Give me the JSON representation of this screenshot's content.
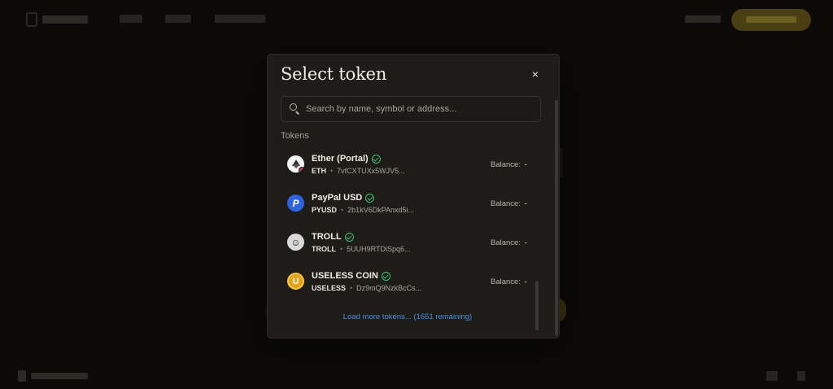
{
  "modal": {
    "title": "Select token",
    "close_glyph": "×",
    "search_placeholder": "Search by name, symbol or address...",
    "section_label": "Tokens",
    "load_more_label": "Load more tokens... (1651 remaining)",
    "tokens": [
      {
        "name": "Ether (Portal)",
        "symbol": "ETH",
        "address": "7vfCXTUXx5WJV5...",
        "balance_label": "Balance:",
        "balance_value": "-",
        "verified": true,
        "icon": "ether-logo-icon"
      },
      {
        "name": "PayPal USD",
        "symbol": "PYUSD",
        "address": "2b1kV6DkPAnxd5i...",
        "balance_label": "Balance:",
        "balance_value": "-",
        "verified": true,
        "icon": "paypal-logo-icon"
      },
      {
        "name": "TROLL",
        "symbol": "TROLL",
        "address": "5UUH9RTDiSpq6...",
        "balance_label": "Balance:",
        "balance_value": "-",
        "verified": true,
        "icon": "troll-face-icon"
      },
      {
        "name": "USELESS COIN",
        "symbol": "USELESS",
        "address": "Dz9mQ9NzkBcCs...",
        "balance_label": "Balance:",
        "balance_value": "-",
        "verified": true,
        "icon": "useless-coin-icon"
      }
    ],
    "token_separator": "•"
  },
  "colors": {
    "overlay_bg": "#0b0a08",
    "modal_bg": "#1d1c19",
    "verified": "#3fbf6d",
    "link": "#4a8fe2",
    "accent_cta": "#4a3f12"
  }
}
